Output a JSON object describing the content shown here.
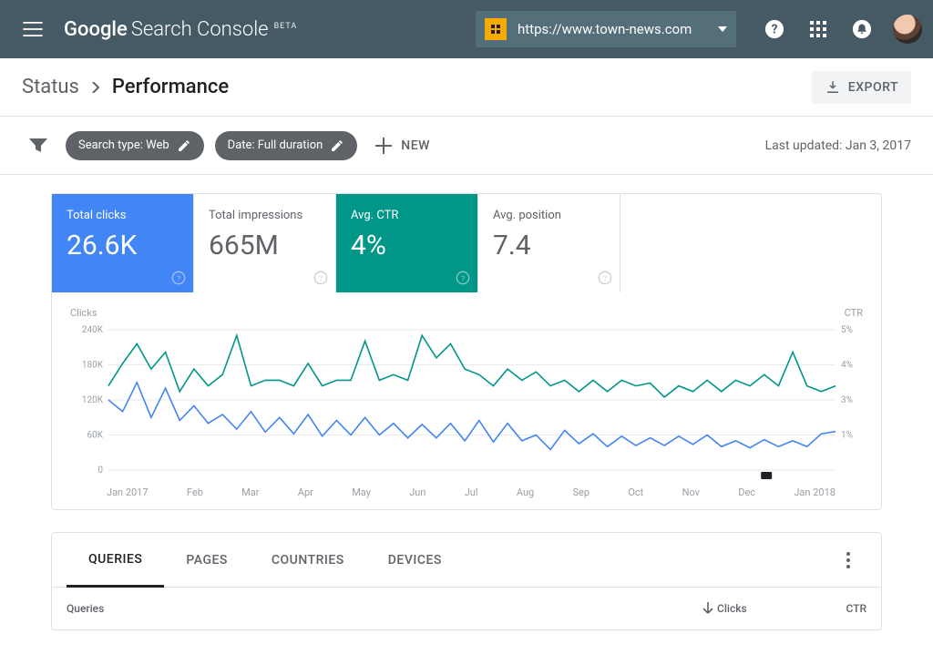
{
  "header": {
    "brand_google": "Google",
    "brand_product": "Search Console",
    "beta": "BETA",
    "property_url": "https://www.town-news.com"
  },
  "breadcrumb": {
    "status": "Status",
    "page": "Performance",
    "export": "EXPORT"
  },
  "filters": {
    "search_type": "Search type: Web",
    "date": "Date: Full duration",
    "new": "NEW",
    "last_updated": "Last updated: Jan 3, 2017"
  },
  "metrics": {
    "clicks_label": "Total clicks",
    "clicks_value": "26.6K",
    "impr_label": "Total impressions",
    "impr_value": "665M",
    "ctr_label": "Avg. CTR",
    "ctr_value": "4%",
    "pos_label": "Avg. position",
    "pos_value": "7.4"
  },
  "chart_axes": {
    "left_label": "Clicks",
    "right_label": "CTR",
    "left_ticks": [
      "240K",
      "180K",
      "120K",
      "60K",
      "0"
    ],
    "right_ticks": [
      "5%",
      "4%",
      "3%",
      "1%",
      ""
    ],
    "x_ticks": [
      "Jan 2017",
      "Feb",
      "Mar",
      "Apr",
      "May",
      "Jun",
      "Jul",
      "Aug",
      "Sep",
      "Oct",
      "Nov",
      "Dec",
      "Jan 2018"
    ]
  },
  "tabs": {
    "queries": "QUERIES",
    "pages": "PAGES",
    "countries": "COUNTRIES",
    "devices": "DEVICES"
  },
  "table": {
    "col_queries": "Queries",
    "col_clicks": "Clicks",
    "col_ctr": "CTR"
  },
  "chart_data": {
    "type": "line",
    "xlabel": "",
    "ylabel_left": "Clicks",
    "ylabel_right": "CTR",
    "ylim_left": [
      0,
      240000
    ],
    "ylim_right": [
      0,
      5
    ],
    "categories": [
      "Jan 2017",
      "Feb",
      "Mar",
      "Apr",
      "May",
      "Jun",
      "Jul",
      "Aug",
      "Sep",
      "Oct",
      "Nov",
      "Dec",
      "Jan 2018"
    ],
    "series": [
      {
        "name": "Clicks (blue)",
        "axis": "left",
        "approx_values_k": [
          120,
          100,
          150,
          90,
          140,
          85,
          110,
          80,
          95,
          70,
          100,
          65,
          90,
          62,
          95,
          58,
          85,
          60,
          90,
          60,
          80,
          55,
          78,
          55,
          80,
          50,
          85,
          48,
          80,
          50,
          60,
          35,
          68,
          45,
          62,
          40,
          58,
          42,
          55,
          42,
          58,
          44,
          60,
          40,
          50,
          38,
          52,
          40,
          50,
          40,
          62,
          66
        ]
      },
      {
        "name": "CTR (green)",
        "axis": "right",
        "approx_values_pct": [
          3.0,
          3.8,
          4.5,
          3.6,
          4.2,
          2.8,
          3.6,
          3.0,
          3.4,
          4.8,
          3.0,
          3.2,
          3.2,
          3.0,
          3.8,
          3.0,
          3.2,
          3.2,
          4.6,
          3.2,
          3.4,
          3.2,
          4.8,
          4.0,
          4.5,
          3.6,
          3.4,
          3.0,
          3.6,
          3.2,
          3.5,
          3.0,
          3.2,
          2.8,
          3.2,
          2.8,
          3.2,
          3.0,
          3.1,
          2.6,
          3.0,
          2.8,
          3.2,
          2.8,
          3.2,
          3.0,
          3.4,
          3.0,
          4.2,
          3.0,
          2.8,
          3.0
        ]
      }
    ]
  }
}
